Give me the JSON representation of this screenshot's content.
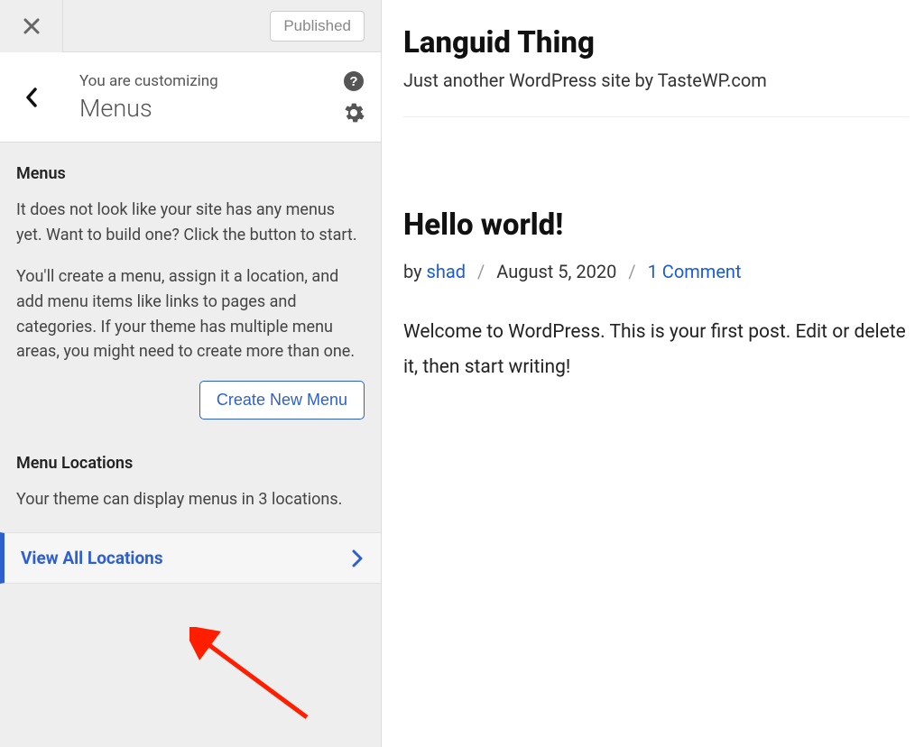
{
  "sidebar": {
    "published_label": "Published",
    "customizing_label": "You are customizing",
    "section_name": "Menus",
    "menus": {
      "title": "Menus",
      "para1": "It does not look like your site has any menus yet. Want to build one? Click the button to start.",
      "para2": "You'll create a menu, assign it a location, and add menu items like links to pages and categories. If your theme has multiple menu areas, you might need to create more than one.",
      "create_button": "Create New Menu"
    },
    "locations": {
      "title": "Menu Locations",
      "subtitle": "Your theme can display menus in 3 locations.",
      "view_all": "View All Locations"
    }
  },
  "preview": {
    "site_title": "Languid Thing",
    "site_tagline": "Just another WordPress site by TasteWP.com",
    "post": {
      "title": "Hello world!",
      "by_label": "by ",
      "author": "shad",
      "date": "August 5, 2020",
      "comments": "1 Comment",
      "body": "Welcome to WordPress. This is your first post. Edit or delete it, then start writing!"
    }
  }
}
